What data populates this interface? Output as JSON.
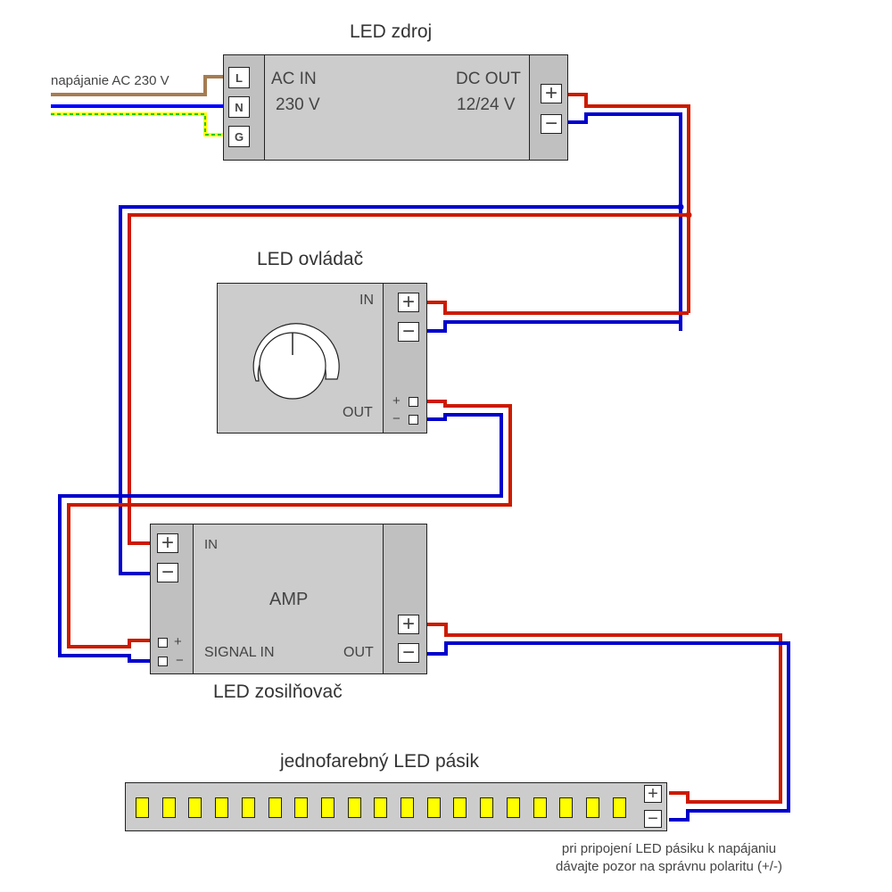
{
  "colors": {
    "positive_wire": "#cc1a00",
    "negative_wire": "#0000cc",
    "live_wire": "#a57c52",
    "neutral_wire": "#0000ff",
    "ground_wire_base": "#ffff00",
    "ground_wire_stripe": "#22cc00",
    "device_body": "#cccccc",
    "terminal_panel": "#c0c0c0",
    "led_chip": "#ffff00"
  },
  "mains_input": {
    "label": "napájanie AC 230 V"
  },
  "power_supply": {
    "title": "LED zdroj",
    "input_terminals": [
      "L",
      "N",
      "G"
    ],
    "ac_in_label": "AC IN",
    "ac_in_voltage": "230 V",
    "dc_out_label": "DC OUT",
    "dc_out_voltage": "12/24 V",
    "output_terminals": [
      "+",
      "−"
    ]
  },
  "controller": {
    "title": "LED ovládač",
    "in_label": "IN",
    "in_terminals": [
      "+",
      "−"
    ],
    "out_label": "OUT",
    "out_terminals": [
      "+",
      "−"
    ]
  },
  "amplifier": {
    "title": "LED zosilňovač",
    "center_label": "AMP",
    "in_label": "IN",
    "in_terminals": [
      "+",
      "−"
    ],
    "signal_in_label": "SIGNAL IN",
    "signal_terminals": [
      "+",
      "−"
    ],
    "out_label": "OUT",
    "out_terminals": [
      "+",
      "−"
    ]
  },
  "led_strip": {
    "title": "jednofarebný LED pásik",
    "led_count": 19,
    "terminals": [
      "+",
      "−"
    ]
  },
  "note": {
    "line1": "pri pripojení LED pásiku k napájaniu",
    "line2": "dávajte pozor na správnu polaritu (+/-)"
  }
}
